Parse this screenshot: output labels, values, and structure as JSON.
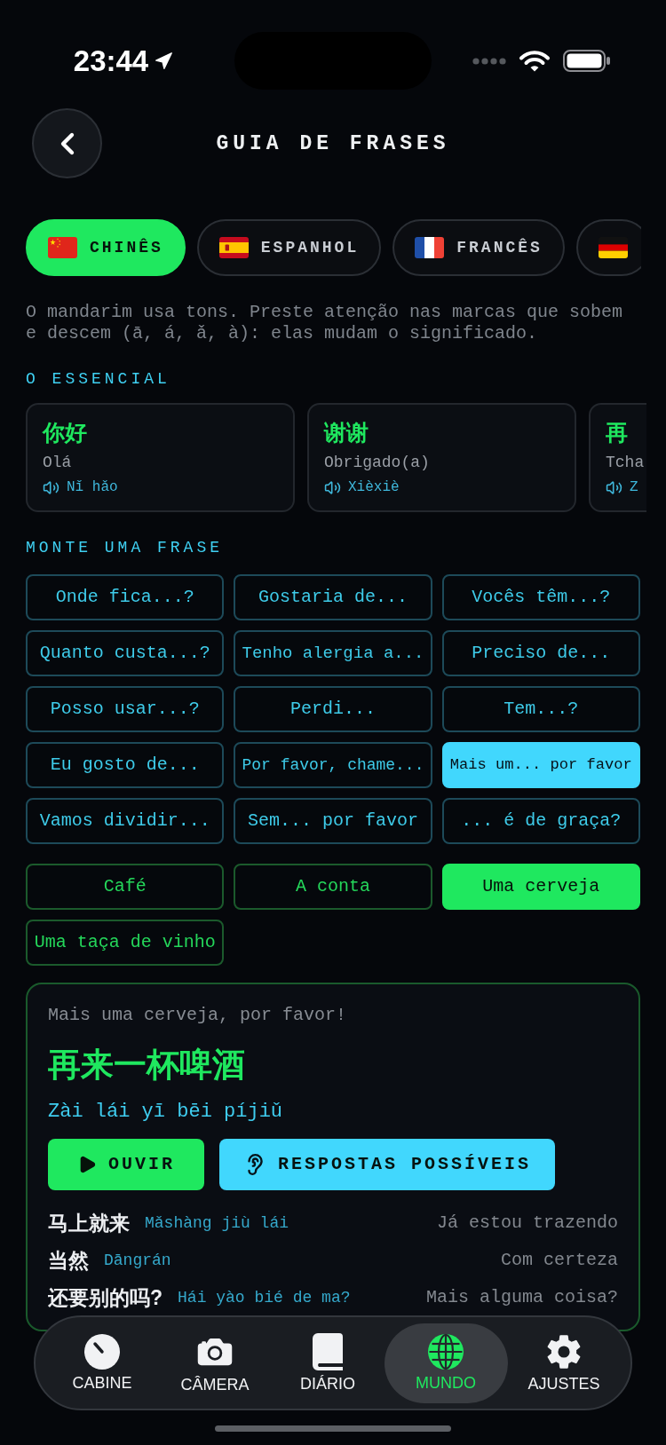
{
  "status_bar": {
    "time": "23:44"
  },
  "header": {
    "title": "GUIA DE FRASES"
  },
  "language_tabs": [
    {
      "kind": "cn",
      "label": "CHINÊS",
      "selected": true
    },
    {
      "kind": "es",
      "label": "ESPANHOL",
      "selected": false
    },
    {
      "kind": "fr",
      "label": "FRANCÊS",
      "selected": false
    },
    {
      "kind": "de",
      "selected": false
    }
  ],
  "tip": "O mandarim usa tons. Preste atenção nas marcas que sobem e descem (ā, á, ǎ, à): elas mudam o significado.",
  "essentials": {
    "title": "O ESSENCIAL",
    "cards": [
      {
        "hanzi": "你好",
        "translation": "Olá",
        "pinyin": "Nǐ hǎo"
      },
      {
        "hanzi": "谢谢",
        "translation": "Obrigado(a)",
        "pinyin": "Xièxiè"
      },
      {
        "hanzi": "再",
        "translation": "Tcha",
        "pinyin": "Z"
      }
    ]
  },
  "builder": {
    "title": "MONTE UMA FRASE",
    "starters": [
      {
        "label": "Onde fica...?",
        "selected": false
      },
      {
        "label": "Gostaria de...",
        "selected": false
      },
      {
        "label": "Vocês têm...?",
        "selected": false
      },
      {
        "label": "Quanto custa...?",
        "selected": false
      },
      {
        "label": "Tenho alergia a...",
        "selected": false
      },
      {
        "label": "Preciso de...",
        "selected": false
      },
      {
        "label": "Posso usar...?",
        "selected": false
      },
      {
        "label": "Perdi...",
        "selected": false
      },
      {
        "label": "Tem...?",
        "selected": false
      },
      {
        "label": "Eu gosto de...",
        "selected": false
      },
      {
        "label": "Por favor, chame...",
        "selected": false
      },
      {
        "label": "Mais um... por favor",
        "selected": true
      },
      {
        "label": "Vamos dividir...",
        "selected": false
      },
      {
        "label": "Sem... por favor",
        "selected": false
      },
      {
        "label": "... é de graça?",
        "selected": false
      }
    ],
    "objects": [
      {
        "label": "Café",
        "selected": false
      },
      {
        "label": "A conta",
        "selected": false
      },
      {
        "label": "Uma cerveja",
        "selected": true
      },
      {
        "label": "Uma taça de vinho",
        "selected": false
      }
    ]
  },
  "result": {
    "translation": "Mais uma cerveja, por favor!",
    "hanzi": "再来一杯啤酒",
    "pinyin": "Zài lái yī bēi píjiǔ",
    "buttons": [
      {
        "kind": "play",
        "label": "OUVIR"
      },
      {
        "kind": "ear",
        "label": "RESPOSTAS POSSÍVEIS"
      }
    ],
    "responses": [
      {
        "hanzi": "马上就来",
        "pinyin": "Mǎshàng jiù lái",
        "meaning": "Já estou trazendo"
      },
      {
        "hanzi": "当然",
        "pinyin": "Dāngrán",
        "meaning": "Com certeza"
      },
      {
        "hanzi": "还要别的吗?",
        "pinyin": "Hái yào bié de ma?",
        "meaning": "Mais alguma coisa?"
      }
    ]
  },
  "bottom_nav": [
    {
      "kind": "gauge",
      "label": "CABINE",
      "selected": false
    },
    {
      "kind": "camera",
      "label": "CÂMERA",
      "selected": false
    },
    {
      "kind": "book",
      "label": "DIÁRIO",
      "selected": false
    },
    {
      "kind": "globe",
      "label": "MUNDO",
      "selected": true
    },
    {
      "kind": "gear",
      "label": "AJUSTES",
      "selected": false
    }
  ]
}
